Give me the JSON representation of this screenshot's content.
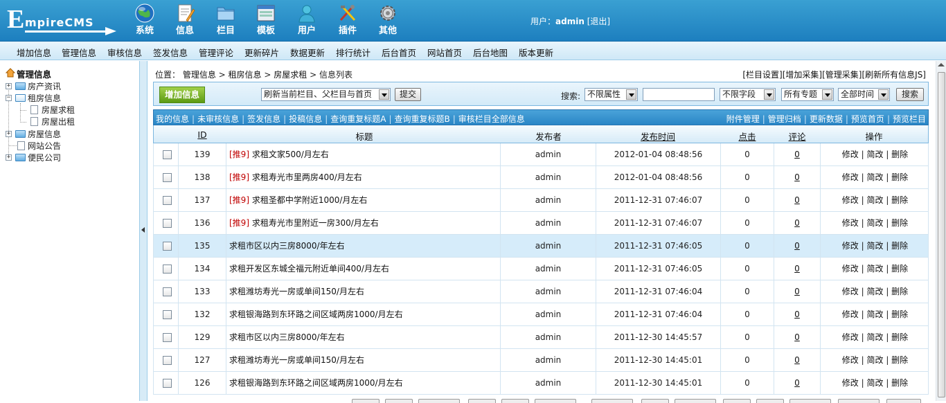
{
  "header": {
    "logo_text": "EmpireCMS",
    "nav": [
      {
        "label": "系统",
        "icon": "globe-icon"
      },
      {
        "label": "信息",
        "icon": "document-icon"
      },
      {
        "label": "栏目",
        "icon": "folder-icon"
      },
      {
        "label": "模板",
        "icon": "window-icon"
      },
      {
        "label": "用户",
        "icon": "user-icon"
      },
      {
        "label": "插件",
        "icon": "tools-icon"
      },
      {
        "label": "其他",
        "icon": "gear-icon"
      }
    ],
    "user_prefix": "用户：",
    "username": "admin",
    "logout": "[退出]"
  },
  "menubar": [
    "增加信息",
    "管理信息",
    "审核信息",
    "签发信息",
    "管理评论",
    "更新碎片",
    "数据更新",
    "排行统计",
    "后台首页",
    "网站首页",
    "后台地图",
    "版本更新"
  ],
  "sidebar": {
    "root": "管理信息",
    "items": {
      "a": "房产资讯",
      "b": "租房信息",
      "b1": "房屋求租",
      "b2": "房屋出租",
      "c": "房屋信息",
      "d": "网站公告",
      "e": "便民公司"
    }
  },
  "breadcrumb": {
    "prefix": "位置：",
    "items": [
      "管理信息",
      "租房信息",
      "房屋求租",
      "信息列表"
    ],
    "sep": " > "
  },
  "top_links": [
    "[栏目设置]",
    "[增加采集]",
    "[管理采集]",
    "[刷新所有信息JS]"
  ],
  "toolbar": {
    "add_button": "增加信息",
    "refresh_select": "刷新当前栏目、父栏目与首页",
    "submit": "提交",
    "search_label": "搜索:",
    "attr_select": "不限属性",
    "search_value": "",
    "field_select": "不限字段",
    "topic_select": "所有专题",
    "time_select": "全部时间",
    "search_button": "搜索"
  },
  "links_left": [
    "我的信息",
    "未审核信息",
    "签发信息",
    "投稿信息",
    "查询重复标题A",
    "查询重复标题B",
    "审核栏目全部信息"
  ],
  "links_right": [
    "附件管理",
    "管理归档",
    "更新数据",
    "预览首页",
    "预览栏目"
  ],
  "table": {
    "headers": {
      "id": "ID",
      "title": "标题",
      "publisher": "发布者",
      "time": "发布时间",
      "clicks": "点击",
      "comments": "评论",
      "ops": "操作"
    },
    "actions": [
      "修改",
      "简改",
      "删除"
    ],
    "rows": [
      {
        "id": "139",
        "push": "[推9]",
        "title": "求租文家500/月左右",
        "publisher": "admin",
        "time": "2012-01-04 08:48:56",
        "clicks": "0",
        "comments": "0"
      },
      {
        "id": "138",
        "push": "[推9]",
        "title": "求租寿光市里两房400/月左右",
        "publisher": "admin",
        "time": "2012-01-04 08:48:56",
        "clicks": "0",
        "comments": "0"
      },
      {
        "id": "137",
        "push": "[推9]",
        "title": "求租圣都中学附近1000/月左右",
        "publisher": "admin",
        "time": "2011-12-31 07:46:07",
        "clicks": "0",
        "comments": "0"
      },
      {
        "id": "136",
        "push": "[推9]",
        "title": "求租寿光市里附近一房300/月左右",
        "publisher": "admin",
        "time": "2011-12-31 07:46:07",
        "clicks": "0",
        "comments": "0"
      },
      {
        "id": "135",
        "push": "",
        "title": "求租市区以内三房8000/年左右",
        "publisher": "admin",
        "time": "2011-12-31 07:46:05",
        "clicks": "0",
        "comments": "0"
      },
      {
        "id": "134",
        "push": "",
        "title": "求租开发区东城全福元附近单间400/月左右",
        "publisher": "admin",
        "time": "2011-12-31 07:46:05",
        "clicks": "0",
        "comments": "0"
      },
      {
        "id": "133",
        "push": "",
        "title": "求租潍坊寿光一房或单间150/月左右",
        "publisher": "admin",
        "time": "2011-12-31 07:46:04",
        "clicks": "0",
        "comments": "0"
      },
      {
        "id": "132",
        "push": "",
        "title": "求租银海路到东环路之间区域两房1000/月左右",
        "publisher": "admin",
        "time": "2011-12-31 07:46:04",
        "clicks": "0",
        "comments": "0"
      },
      {
        "id": "129",
        "push": "",
        "title": "求租市区以内三房8000/年左右",
        "publisher": "admin",
        "time": "2011-12-30 14:45:57",
        "clicks": "0",
        "comments": "0"
      },
      {
        "id": "127",
        "push": "",
        "title": "求租潍坊寿光一房或单间150/月左右",
        "publisher": "admin",
        "time": "2011-12-30 14:45:01",
        "clicks": "0",
        "comments": "0"
      },
      {
        "id": "126",
        "push": "",
        "title": "求租银海路到东环路之间区域两房1000/月左右",
        "publisher": "admin",
        "time": "2011-12-30 14:45:01",
        "clicks": "0",
        "comments": "0"
      }
    ]
  },
  "colors": {
    "header": "#2a8ecb",
    "accent_green": "#6aa61c",
    "highlight_row": "#d6ecfa",
    "push_red": "#c00000"
  }
}
